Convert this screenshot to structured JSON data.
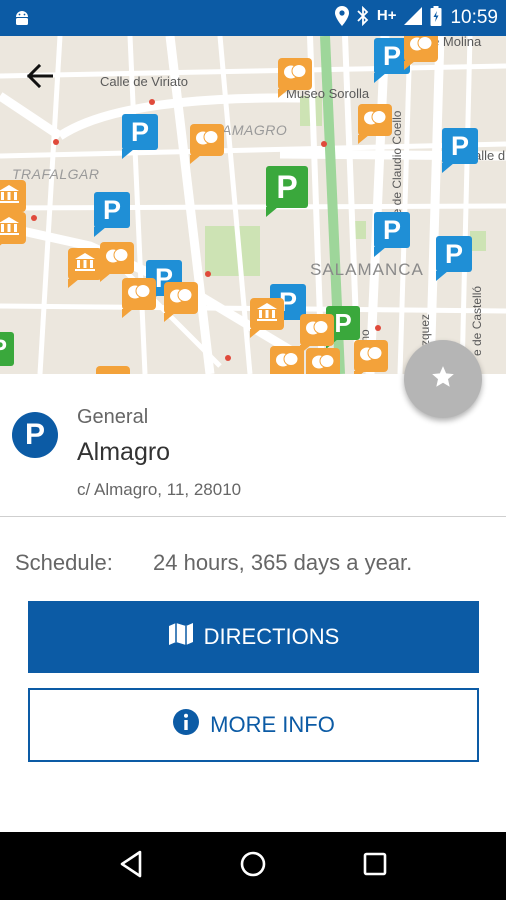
{
  "status_bar": {
    "network": "H+",
    "time": "10:59"
  },
  "map": {
    "labels": {
      "calle_viriato": "Calle de Viriato",
      "museo_sorolla": "Museo Sorolla",
      "almagro_area": "AMAGRO",
      "trafalgar": "TRAFALGAR",
      "salamanca": "SALAMANCA",
      "calle_molina": "e de Molina",
      "calle_claudio_coello": "Calle de Claudio Coello",
      "calle_castello": "e de Castelló",
      "vazquez": "zquez",
      "serrano": "Serrano",
      "calle_side": "alle d"
    }
  },
  "place": {
    "category": "General",
    "name": "Almagro",
    "address": "c/ Almagro, 11, 28010",
    "icon_letter": "P",
    "schedule_label": "Schedule:",
    "schedule_value": "24 hours, 365 days a year."
  },
  "actions": {
    "directions_label": "DIRECTIONS",
    "more_info_label": "MORE INFO"
  },
  "icons": {
    "back": "arrow-left-icon",
    "favorite": "star-icon",
    "directions": "map-icon",
    "more_info": "info-icon"
  },
  "colors": {
    "primary": "#0c5ba5",
    "parking_pin": "#1f8fd6",
    "parking_pin_selected": "#3aa83c",
    "culture_pin": "#f3a23a",
    "fab": "#b5b5b5"
  }
}
